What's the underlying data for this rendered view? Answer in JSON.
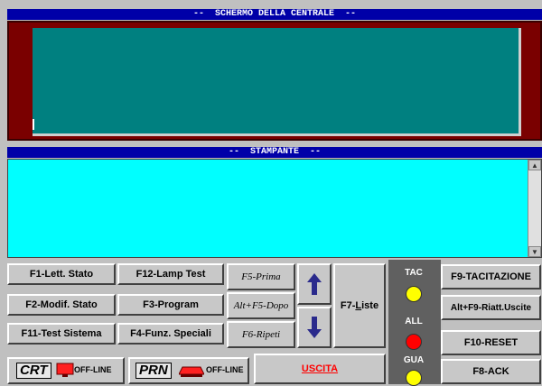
{
  "screen": {
    "title": "--  SCHERMO DELLA CENTRALE  --"
  },
  "printer": {
    "title": "--  STAMPANTE  --"
  },
  "buttons": {
    "f1": "F1-Lett. Stato",
    "f12": "F12-Lamp Test",
    "f2": "F2-Modif. Stato",
    "f3": "F3-Program",
    "f11": "F11-Test Sistema",
    "f4": "F4-Funz. Speciali",
    "f5": "F5-Prima",
    "altf5": "Alt+F5-Dopo",
    "f6": "F6-Ripeti",
    "f7_pre": "F7-",
    "f7_underlined": "L",
    "f7_post": "iste",
    "f9": "F9-TACITAZIONE",
    "altf9": "Alt+F9-Riatt.Uscite",
    "f10": "F10-RESET",
    "f8": "F8-ACK",
    "uscita": "USCITA"
  },
  "leds": [
    {
      "label": "TAC",
      "color": "#ffff00"
    },
    {
      "label": "ALL",
      "color": "#ff0000"
    },
    {
      "label": "GUA",
      "color": "#ffff00"
    }
  ],
  "status": {
    "crt_tag": "CRT",
    "crt_state": "OFF-LINE",
    "prn_tag": "PRN",
    "prn_state": "OFF-LINE"
  },
  "colors": {
    "title_bar": "#0000a8",
    "crt_frame": "#7a0000",
    "crt_screen": "#008080",
    "printer_paper": "#00ffff",
    "uscita_text": "#ff0000"
  }
}
